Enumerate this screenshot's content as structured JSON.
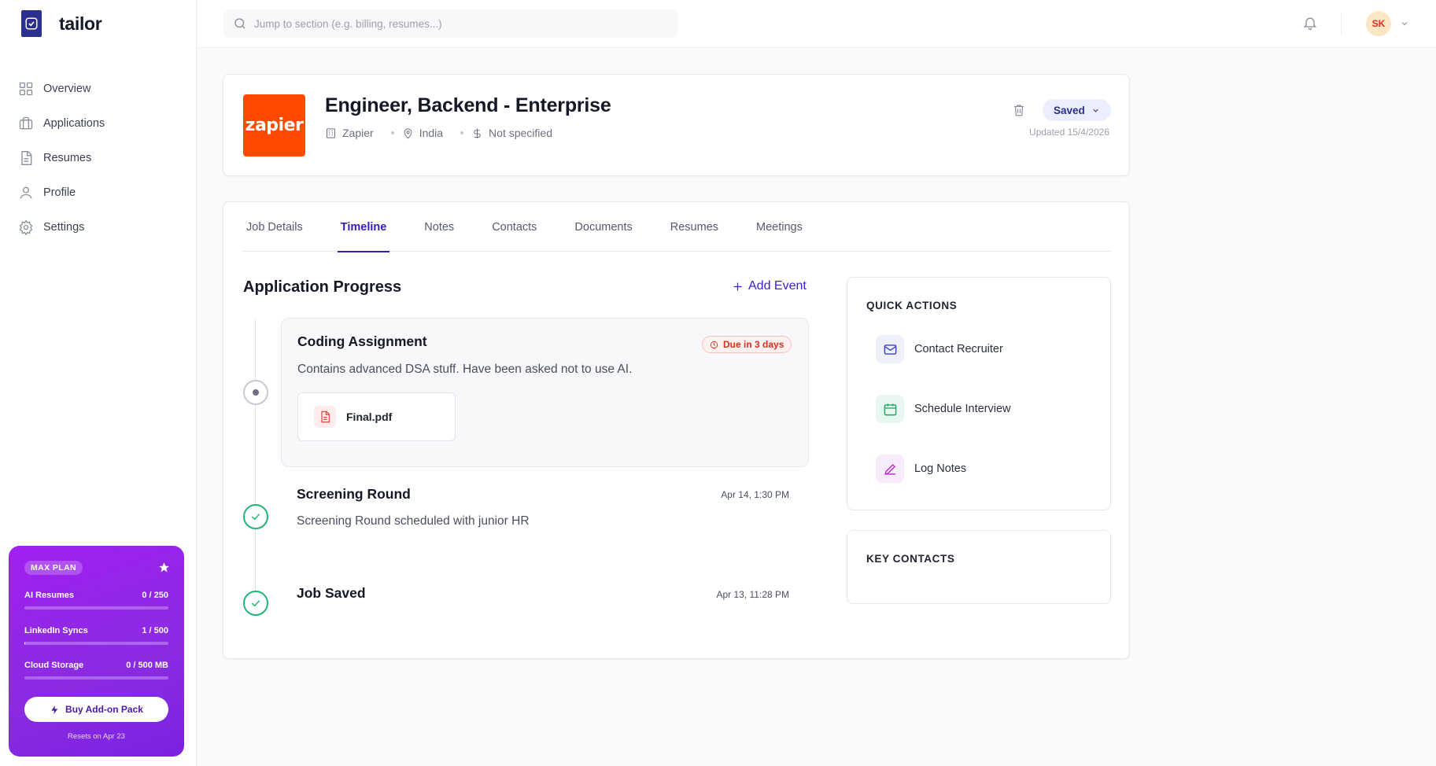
{
  "brand": {
    "name": "tailor"
  },
  "sidebar": {
    "items": [
      {
        "label": "Overview",
        "icon": "grid-icon"
      },
      {
        "label": "Applications",
        "icon": "briefcase-icon"
      },
      {
        "label": "Resumes",
        "icon": "document-icon"
      },
      {
        "label": "Profile",
        "icon": "user-icon"
      },
      {
        "label": "Settings",
        "icon": "gear-icon"
      }
    ],
    "plan": {
      "badge": "MAX PLAN",
      "usage": [
        {
          "label": "AI Resumes",
          "value": "0 / 250",
          "fraction": 0.0
        },
        {
          "label": "LinkedIn Syncs",
          "value": "1 / 500",
          "fraction": 0.002
        },
        {
          "label": "Cloud Storage",
          "value": "0 / 500 MB",
          "fraction": 0.0
        }
      ],
      "button_label": "Buy Add-on Pack",
      "reset_text": "Resets on Apr 23"
    }
  },
  "topbar": {
    "search_placeholder": "Jump to section (e.g. billing, resumes...)",
    "avatar_initials": "SK"
  },
  "job": {
    "company_logo_text": "zapier",
    "title": "Engineer, Backend - Enterprise",
    "company": "Zapier",
    "location": "India",
    "salary": "Not specified",
    "status": "Saved",
    "updated": "Updated 15/4/2026"
  },
  "tabs": [
    {
      "label": "Job Details",
      "active": false
    },
    {
      "label": "Timeline",
      "active": true
    },
    {
      "label": "Notes",
      "active": false
    },
    {
      "label": "Contacts",
      "active": false
    },
    {
      "label": "Documents",
      "active": false
    },
    {
      "label": "Resumes",
      "active": false
    },
    {
      "label": "Meetings",
      "active": false
    }
  ],
  "timeline": {
    "title": "Application Progress",
    "add_event_label": "Add Event",
    "events": [
      {
        "title": "Coding Assignment",
        "description": "Contains advanced DSA stuff. Have been asked not to use AI.",
        "badge": "Due in 3 days",
        "file": "Final.pdf",
        "status": "pending"
      },
      {
        "title": "Screening Round",
        "description": "Screening Round scheduled with junior HR",
        "time": "Apr 14, 1:30 PM",
        "status": "done"
      },
      {
        "title": "Job Saved",
        "time": "Apr 13, 11:28 PM",
        "status": "done"
      }
    ]
  },
  "quick_actions": {
    "heading": "QUICK ACTIONS",
    "items": [
      {
        "label": "Contact Recruiter",
        "icon": "mail-icon",
        "color": "#3a3fc4",
        "bg": "#eef0fb"
      },
      {
        "label": "Schedule Interview",
        "icon": "calendar-icon",
        "color": "#1fa866",
        "bg": "#e8f7ef"
      },
      {
        "label": "Log Notes",
        "icon": "pen-icon",
        "color": "#b52bc9",
        "bg": "#f8ebfb"
      }
    ]
  },
  "key_contacts": {
    "heading": "KEY CONTACTS"
  },
  "colors": {
    "accent": "#3320b5",
    "plan_gradient_start": "#a020f0",
    "company_brand": "#ff4a00",
    "success": "#22b573",
    "danger": "#d5321f"
  }
}
